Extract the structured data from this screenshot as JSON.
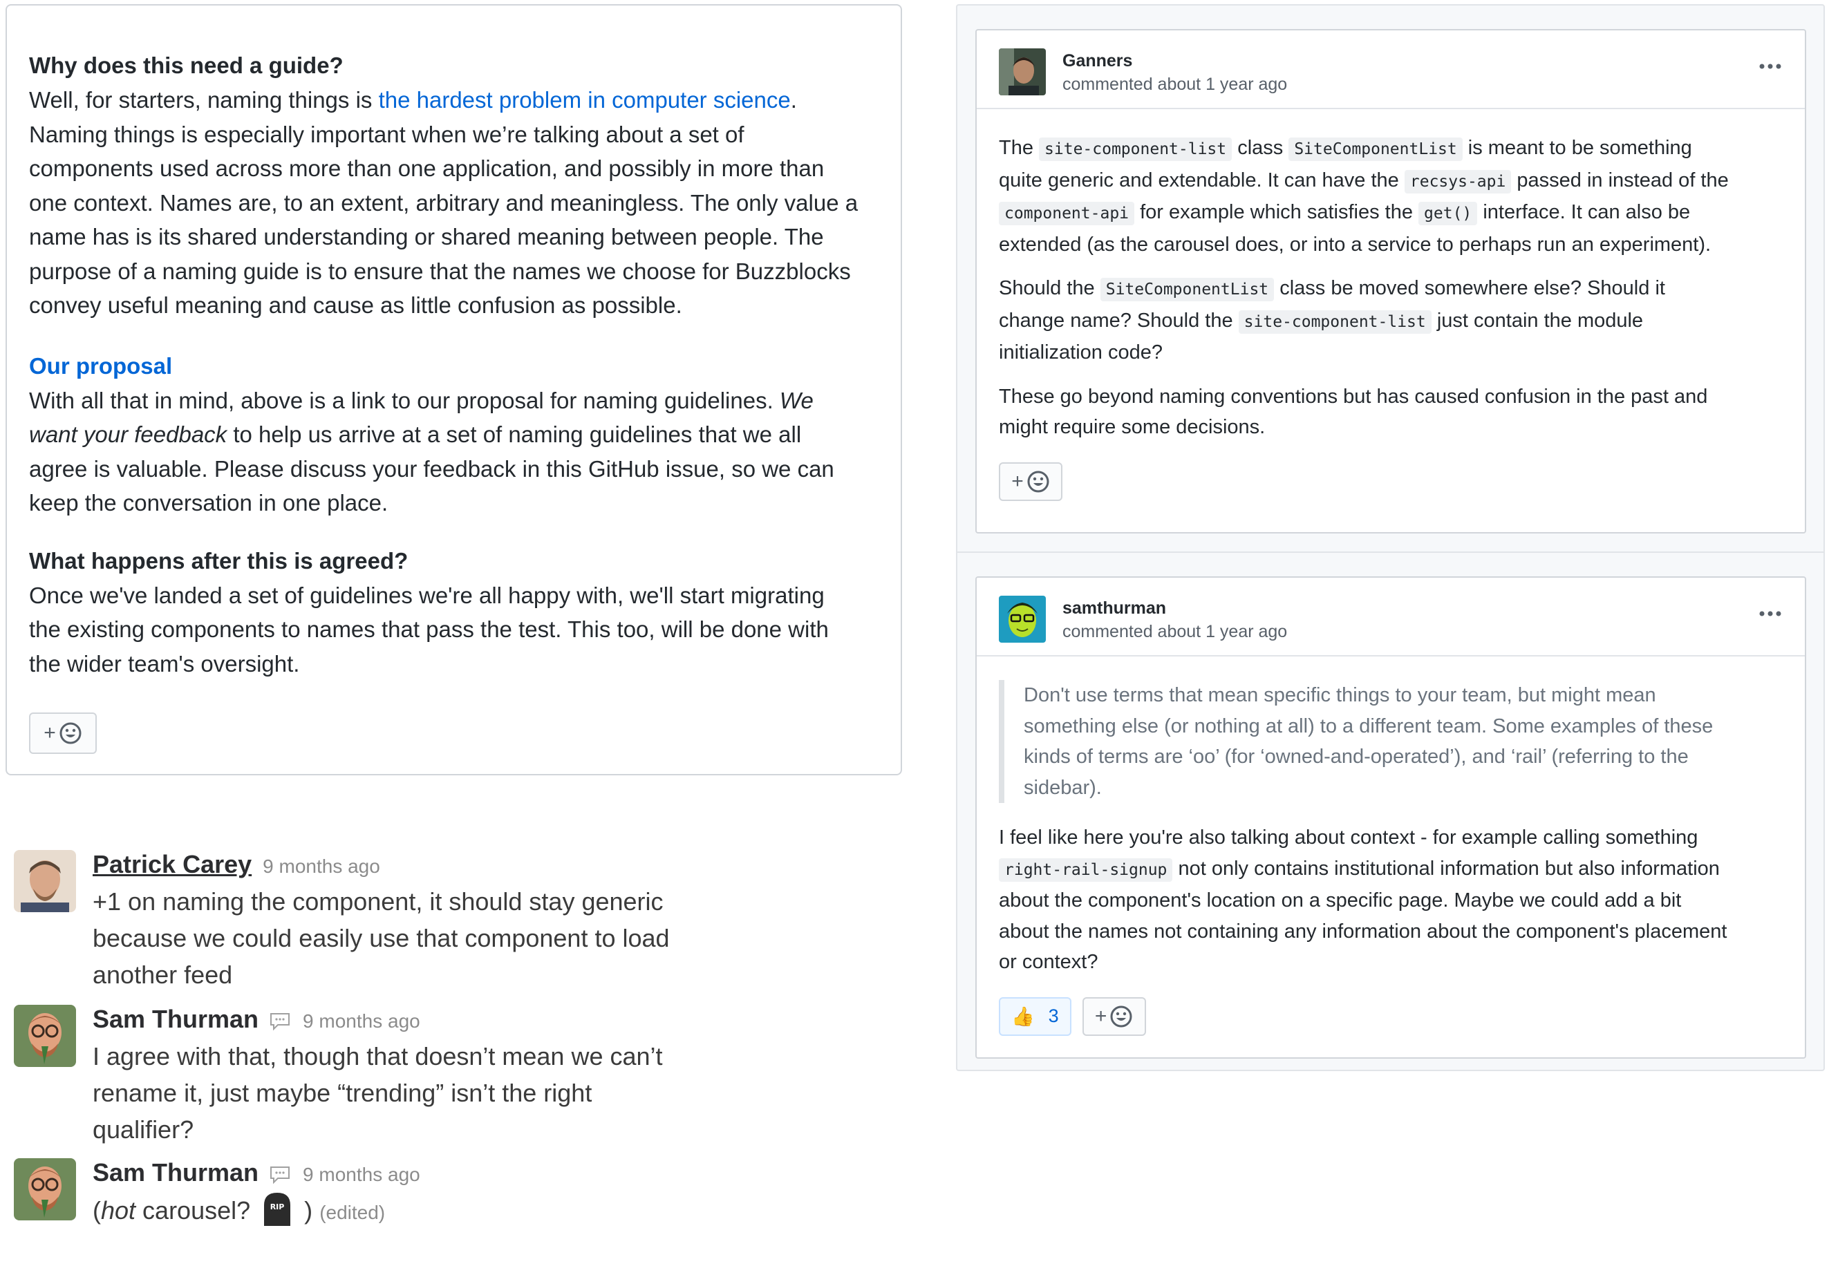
{
  "issue": {
    "section1_title": "Why does this need a guide?",
    "s1_l1_pre": "Well, for starters, naming things is ",
    "s1_l1_link": "the hardest problem in computer science",
    "s1_l1_post": ".",
    "s1_l2": "Naming things is especially important when we’re talking about a set of",
    "s1_l3": "components used across more than one application, and possibly in more than",
    "s1_l4": "one context. Names are, to an extent, arbitrary and meaningless. The only value a",
    "s1_l5": "name has is its shared understanding or shared meaning between people. The",
    "s1_l6": "purpose of a naming guide is to ensure that the names we choose for Buzzblocks",
    "s1_l7": "convey useful meaning and cause as little confusion as possible.",
    "section2_title": "Our proposal",
    "s2_l1_pre": "With all that in mind, above is a link to our proposal for naming guidelines. ",
    "s2_l1_em": "We",
    "s2_l2_em": "want your feedback",
    "s2_l2_post": " to help us arrive at a set of naming guidelines that we all",
    "s2_l3": "agree is valuable. Please discuss your feedback in this GitHub issue, so we can",
    "s2_l4": "keep the conversation in one place.",
    "section3_title": "What happens after this is agreed?",
    "s3_l1": "Once we've landed a set of guidelines we're all happy with, we'll start migrating",
    "s3_l2": "the existing components to names that pass the test. This too, will be done with",
    "s3_l3": "the wider team's oversight.",
    "react_plus": "+"
  },
  "slack": {
    "m1": {
      "name": "Patrick Carey",
      "time": "9 months ago",
      "l1": "+1 on naming the component, it should stay generic",
      "l2": "because we could easily use that component to load",
      "l3": "another feed"
    },
    "m2": {
      "name": "Sam Thurman",
      "time": "9 months ago",
      "l1": "I agree with that, though that doesn’t mean we can’t",
      "l2": "rename it, just maybe “trending” isn’t the right",
      "l3": "qualifier?"
    },
    "m3": {
      "name": "Sam Thurman",
      "time": "9 months ago",
      "open": "(",
      "em": "hot",
      "mid": " carousel? ",
      "close": ")",
      "edited": "(edited)",
      "rip_text": "RIP"
    }
  },
  "comments": [
    {
      "author": "Ganners",
      "meta": "commented about 1 year ago",
      "p1_l1": [
        "The ",
        "site-component-list",
        " class ",
        "SiteComponentList",
        " is meant to be something"
      ],
      "p1_l2": [
        "quite generic and extendable. It can have the ",
        "recsys-api",
        " passed in instead of the"
      ],
      "p1_l3": [
        "component-api",
        " for example which satisfies the ",
        "get()",
        " interface. It can also be"
      ],
      "p1_l4": "extended (as the carousel does, or into a service to perhaps run an experiment).",
      "p2_l1": [
        "Should the ",
        "SiteComponentList",
        " class be moved somewhere else? Should it"
      ],
      "p2_l2": [
        "change name? Should the ",
        "site-component-list",
        " just contain the module"
      ],
      "p2_l3": "initialization code?",
      "p3_l1": "These go beyond naming conventions but has caused confusion in the past and",
      "p3_l2": "might require some decisions.",
      "react_plus": "+"
    },
    {
      "author": "samthurman",
      "meta": "commented about 1 year ago",
      "q_l1": "Don't use terms that mean specific things to your team, but might mean",
      "q_l2": "something else (or nothing at all) to a different team. Some examples of these",
      "q_l3": "kinds of terms are ‘oo’ (for ‘owned-and-operated’), and ‘rail’ (referring to the",
      "q_l4": "sidebar).",
      "p_l1": "I feel like here you're also talking about context - for example calling something",
      "p_l2": [
        "right-rail-signup",
        " not only contains institutional information but also information"
      ],
      "p_l3": "about the component's location on a specific page. Maybe we could add a bit",
      "p_l4": "about the names not containing any information about the component's placement",
      "p_l5": "or context?",
      "thumbs_emoji": "👍",
      "thumbs_count": "3",
      "react_plus": "+"
    }
  ],
  "colors": {
    "link": "#0366d6",
    "border": "#d1d5da",
    "reaction_bg": "#f1f8ff"
  }
}
